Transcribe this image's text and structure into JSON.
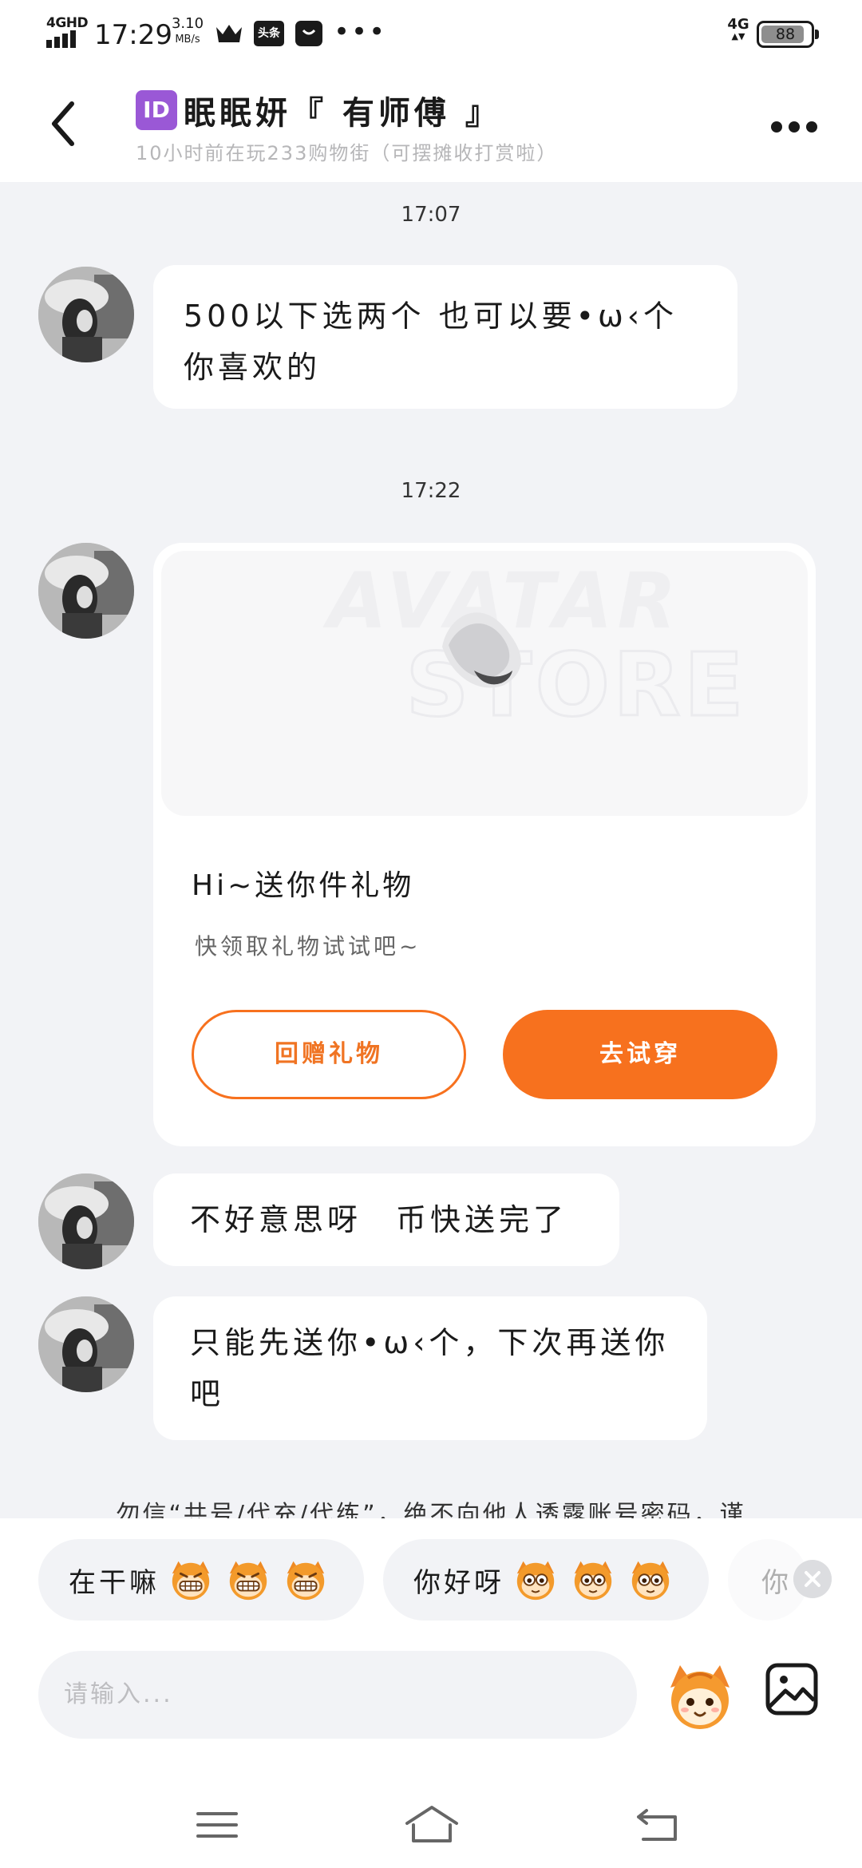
{
  "status_bar": {
    "network_type": "4GHD",
    "time": "17:29",
    "speed_value": "3.10",
    "speed_unit": "MB/s",
    "news_app": "头条",
    "more_notifications": "•••",
    "cellular": "4G",
    "battery_level": "88",
    "battery_fraction": 0.88,
    "signal_bars": 4
  },
  "header": {
    "back_icon": "chevron-left-icon",
    "id_badge": "ID",
    "nickname": "眠眠妍『 有师傅 』",
    "subtitle": "10小时前在玩233购物街（可摆摊收打赏啦）",
    "more_icon": "more-dots-icon"
  },
  "chat": {
    "timestamp_1": "17:07",
    "message_1": "500以下选两个 也可以要•ω‹个你喜欢的",
    "timestamp_2": "17:22",
    "gift_card": {
      "watermark_line1": "AVATAR",
      "watermark_line2": "STORE",
      "title": "Hi~送你件礼物",
      "subtitle": "快领取礼物试试吧~",
      "return_gift_label": "回赠礼物",
      "try_on_label": "去试穿"
    },
    "message_2": "不好意思呀　币快送完了",
    "message_3": "只能先送你•ω‹个，下次再送你吧"
  },
  "safety_notice": "勿信“共号/代充/代练”，绝不向他人透露账号密码，谨",
  "quick_replies": [
    {
      "text": "在干嘛",
      "emoji": "grinning-monkey-icon"
    },
    {
      "text": "你好呀",
      "emoji": "wide-eyed-monkey-icon"
    },
    {
      "text": "你"
    }
  ],
  "composer": {
    "placeholder": "请输入...",
    "emoji_button": "mascot-emoji-icon",
    "image_button": "image-icon"
  },
  "nav_bar": {
    "menu": "menu-icon",
    "home": "home-icon",
    "back": "back-icon"
  },
  "colors": {
    "accent": "#f7711e",
    "page_background": "#f2f3f6",
    "bubble": "#ffffff",
    "id_badge": "#9a58d6"
  }
}
